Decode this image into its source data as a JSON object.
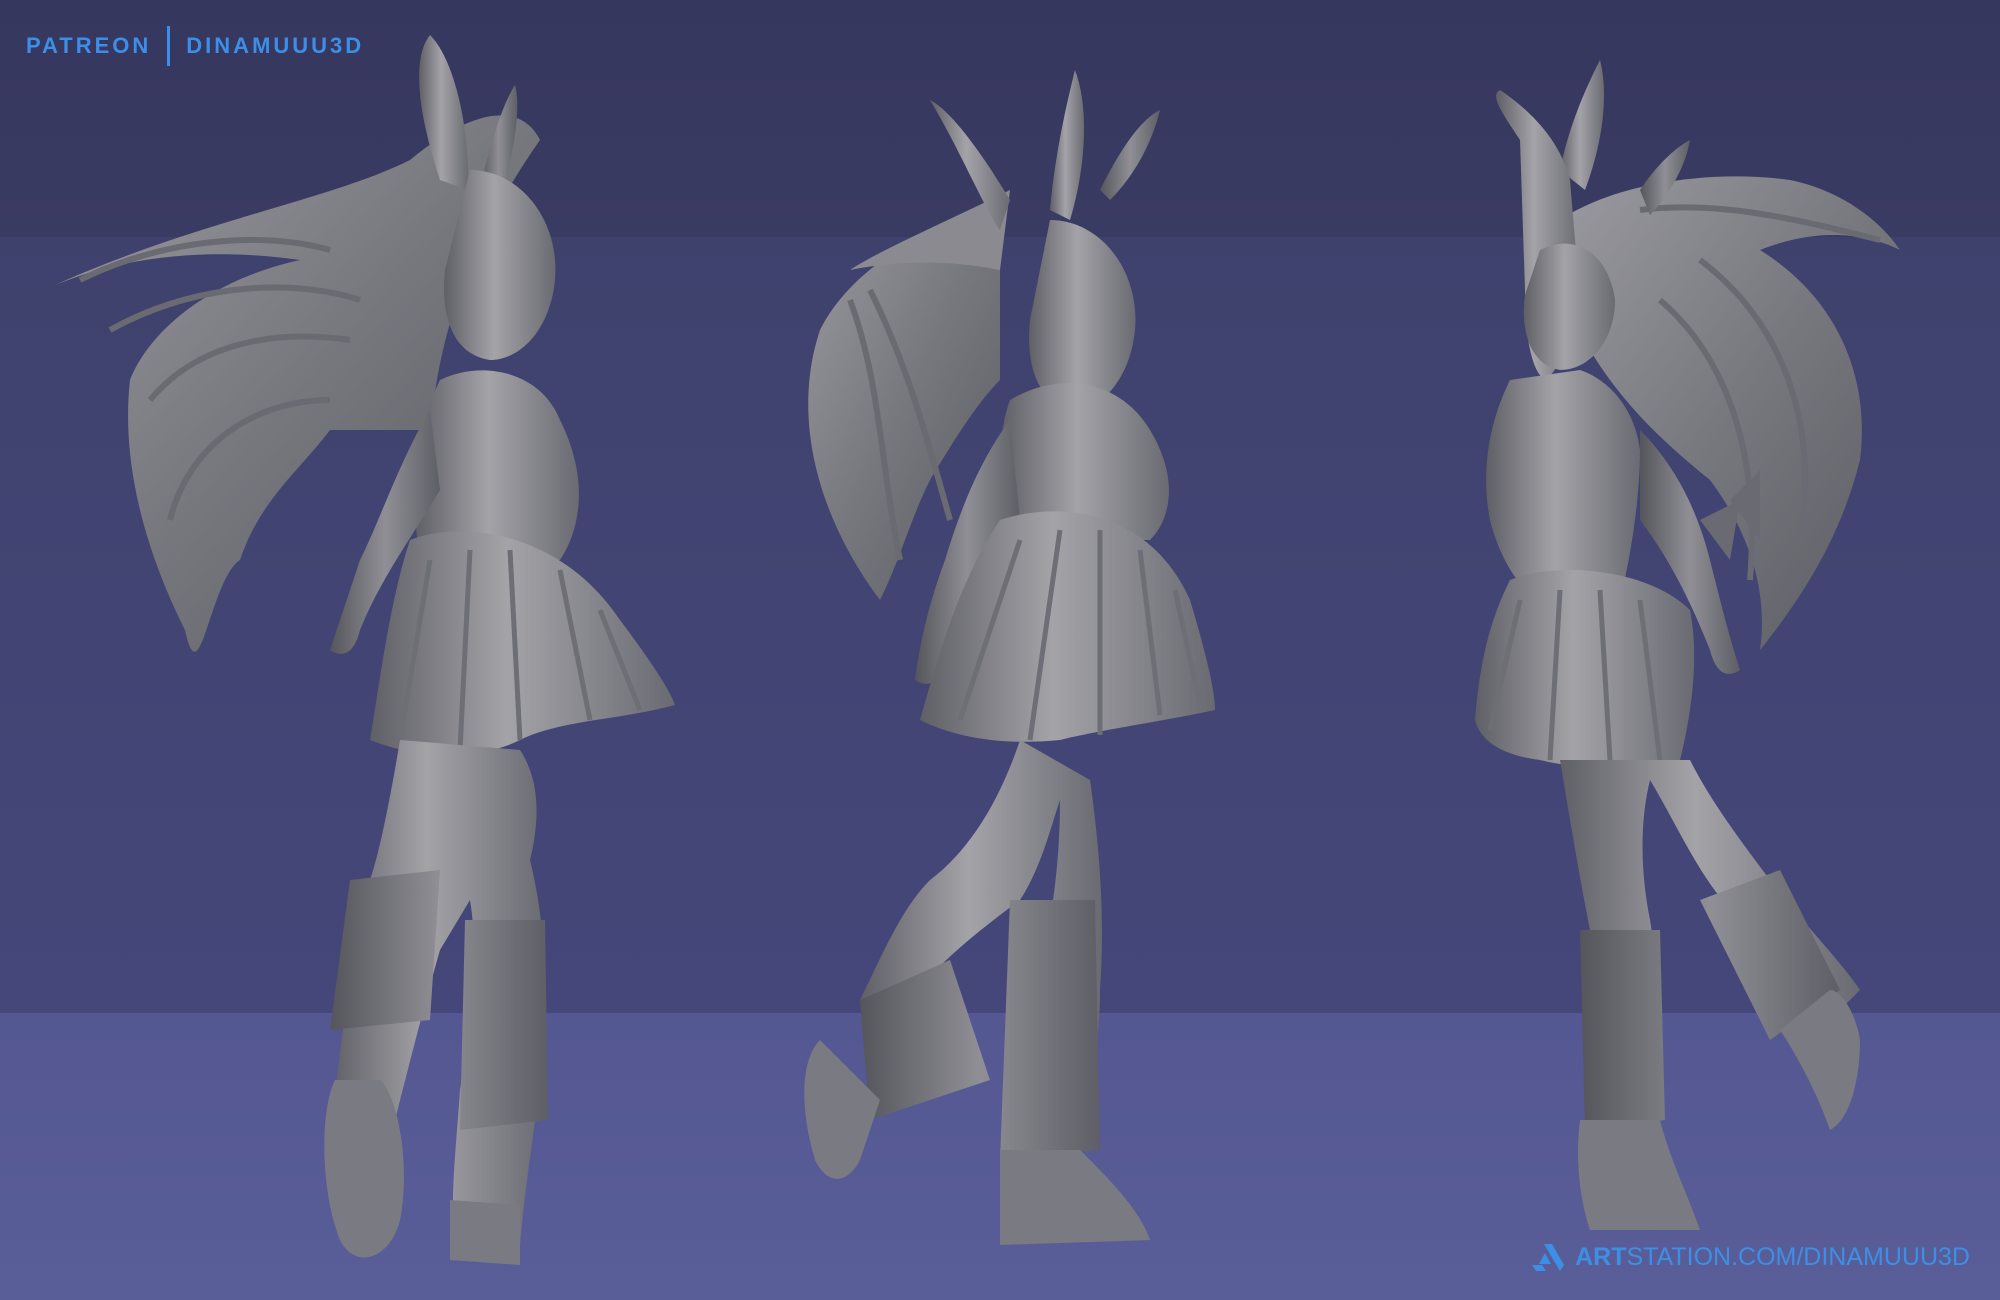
{
  "header": {
    "left_label": "PATREON",
    "right_label": "DINAMUUU3D"
  },
  "footer": {
    "url_bold": "ART",
    "url_rest": "STATION.COM/DINAMUUU3D",
    "icon": "artstation-logo-icon"
  },
  "figures": [
    {
      "view": "back-three-quarter",
      "icon": "sculpt-figure"
    },
    {
      "view": "front-three-quarter",
      "icon": "sculpt-figure"
    },
    {
      "view": "side-raised-arm",
      "icon": "sculpt-figure"
    }
  ],
  "colors": {
    "background_top": "#36375e",
    "background_mid": "#42446f",
    "background_floor": "#575a94",
    "sculpt_gray": "#8c8c92",
    "brand_blue": "#3b8fe8"
  }
}
